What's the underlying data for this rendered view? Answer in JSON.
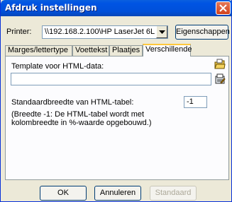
{
  "window": {
    "title": "Afdruk instellingen"
  },
  "printer": {
    "label": "Printer:",
    "value": "\\\\192.168.2.100\\HP LaserJet 6L",
    "properties_button": "Eigenschappen"
  },
  "tabs": [
    {
      "label": "Marges/lettertype",
      "active": false
    },
    {
      "label": "Voettekst",
      "active": false
    },
    {
      "label": "Plaatjes",
      "active": false
    },
    {
      "label": "Verschillende",
      "active": true
    }
  ],
  "panel": {
    "template_label": "Template voor HTML-data:",
    "template_value": "",
    "width_label": "Standaardbreedte van HTML-tabel:",
    "width_value": "-1",
    "note_line1": "(Breedte -1: De HTML-tabel wordt met",
    "note_line2": "kolombreedte in %-waarde opgebouwd.)"
  },
  "buttons": {
    "ok": "OK",
    "cancel": "Annuleren",
    "default": "Standaard"
  },
  "colors": {
    "title_bar": "#0054e3",
    "window": "#ece9d8",
    "close": "#d2411c"
  }
}
